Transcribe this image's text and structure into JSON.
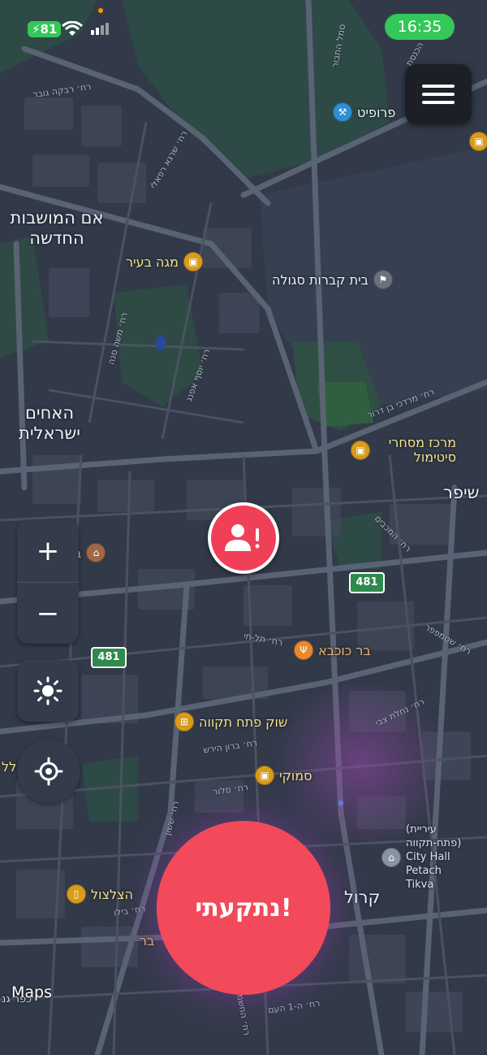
{
  "status_bar": {
    "battery": "81",
    "time": "16:35"
  },
  "menu": {
    "icon": "hamburger-icon"
  },
  "map": {
    "places": {
      "neighborhood_em": "אם המושבות החדשה",
      "neighborhood_achim": "האחים ישראלית",
      "shifer": "שיפר",
      "krol": "קרול",
      "beit_kvarot": "בית קברות סגולה",
      "profit": "פרופיט",
      "mega": "מגה בעיר",
      "sitimol": "מרכז מסחרי סיטימול",
      "bar_kochva": "בר כוכבא",
      "shuk": "שוק פתח תקווה",
      "smoki": "סמוקי",
      "hatzalzul": "הצלצול",
      "city_hall": "(עיריית פתח-תקווה) City Hall Petach Tikva",
      "bar_cut": "בר",
      "cut_left_1": "ביי",
      "cut_left_2": "לל",
      "cut_bottom": "כפר גנ"
    },
    "streets": {
      "s1": "רח׳ רבקה גובר",
      "s2": "רח׳ שרגא רפאלי",
      "s3": "רח׳ משה סנה",
      "s4": "רח׳ יוסף אפנג",
      "s5": "רח׳ מרדכי בן דרור",
      "s6": "רח׳ המכבים",
      "s7": "רח׳ תל-חי",
      "s8": "רח׳ שטמפפר",
      "s9": "רח׳ נחלת צבי",
      "s10": "רח׳ ברון הירש",
      "s11": "רח׳ סלור",
      "s12": "רח׳ בילו",
      "s13": "רח׳ החשמונאים",
      "s14": "רח׳ ה-1 העם",
      "s15": "סמל התבור",
      "s16": "רח׳ ששון",
      "s17": "הכנסת"
    },
    "highway_shield": "481"
  },
  "controls": {
    "zoom_in": "+",
    "zoom_out": "−"
  },
  "panic_button": {
    "label": "נתקעתי!"
  },
  "attribution": "Maps"
}
